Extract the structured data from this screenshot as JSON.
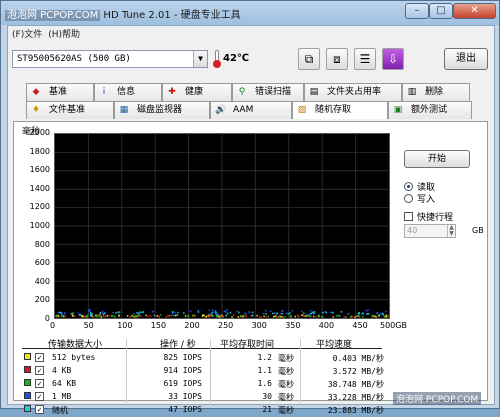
{
  "window": {
    "title_prefix": "泡泡网 PCPOP.COM",
    "title_fragment": "HD Tune 2.01",
    "title_suffix": "- 硬盘专业工具",
    "min_label": "–",
    "max_label": "□",
    "close_label": "✕"
  },
  "menu": [
    "(F)文件",
    "(H)帮助"
  ],
  "drive": {
    "name": "ST95005620AS (500 GB)",
    "temperature": "42℃"
  },
  "toolbar": {
    "exit_label": "退出"
  },
  "tabs_top": [
    {
      "label": "基准",
      "icon": "benchmark-icon"
    },
    {
      "label": "信息",
      "icon": "info-icon"
    },
    {
      "label": "健康",
      "icon": "health-icon"
    },
    {
      "label": "错误扫描",
      "icon": "error-scan-icon"
    },
    {
      "label": "文件夹占用率",
      "icon": "folder-usage-icon"
    },
    {
      "label": "删除",
      "icon": "erase-icon"
    }
  ],
  "tabs_bottom": [
    {
      "label": "文件基准",
      "icon": "file-benchmark-icon"
    },
    {
      "label": "磁盘监视器",
      "icon": "disk-monitor-icon"
    },
    {
      "label": "AAM",
      "icon": "aam-icon"
    },
    {
      "label": "随机存取",
      "icon": "random-access-icon",
      "active": true
    },
    {
      "label": "额外测试",
      "icon": "extra-tests-icon"
    }
  ],
  "controls": {
    "start_label": "开始",
    "read_label": "读取",
    "write_label": "写入",
    "mode_selected": "读取",
    "fast_label": "快捷行程",
    "fast_checked": false,
    "fast_value": "40",
    "fast_unit": "GB"
  },
  "chart_data": {
    "type": "scatter",
    "ylabel": "毫秒",
    "ylim": [
      0,
      2000
    ],
    "yticks": [
      0,
      200,
      400,
      600,
      800,
      1000,
      1200,
      1400,
      1600,
      1800,
      2000
    ],
    "xlim": [
      0,
      500
    ],
    "xticks": [
      "0",
      "50",
      "100",
      "150",
      "200",
      "250",
      "300",
      "350",
      "400",
      "450",
      "500GB"
    ],
    "grid": true,
    "background": "#000000",
    "series": [
      {
        "name": "512 bytes",
        "color": "#f0e020",
        "level_ms": 1.2
      },
      {
        "name": "4 KB",
        "color": "#d02020",
        "level_ms": 1.1
      },
      {
        "name": "64 KB",
        "color": "#20b020",
        "level_ms": 1.6
      },
      {
        "name": "1 MB",
        "color": "#2050e0",
        "level_ms": 30
      },
      {
        "name": "随机",
        "color": "#20c8d8",
        "level_ms": 21
      }
    ]
  },
  "results": {
    "headers": [
      "传输数据大小",
      "操作 / 秒",
      "平均存取时间",
      "平均速度"
    ],
    "rows": [
      {
        "size": "512 bytes",
        "ops": "825 IOPS",
        "time": "1.2",
        "time_unit": "毫秒",
        "speed": "0.403 MB/秒",
        "color": "#f0e020",
        "checked": true
      },
      {
        "size": "4 KB",
        "ops": "914 IOPS",
        "time": "1.1",
        "time_unit": "毫秒",
        "speed": "3.572 MB/秒",
        "color": "#d02020",
        "checked": true
      },
      {
        "size": "64 KB",
        "ops": "619 IOPS",
        "time": "1.6",
        "time_unit": "毫秒",
        "speed": "38.748 MB/秒",
        "color": "#20b020",
        "checked": true
      },
      {
        "size": "1 MB",
        "ops": "33 IOPS",
        "time": "30",
        "time_unit": "毫秒",
        "speed": "33.228 MB/秒",
        "color": "#2050e0",
        "checked": true
      },
      {
        "size": "随机",
        "ops": "47 IOPS",
        "time": "21",
        "time_unit": "毫秒",
        "speed": "23.883 MB/秒",
        "color": "#20c8d8",
        "checked": true
      }
    ]
  },
  "watermark": "泡泡网 PCPOP.COM"
}
